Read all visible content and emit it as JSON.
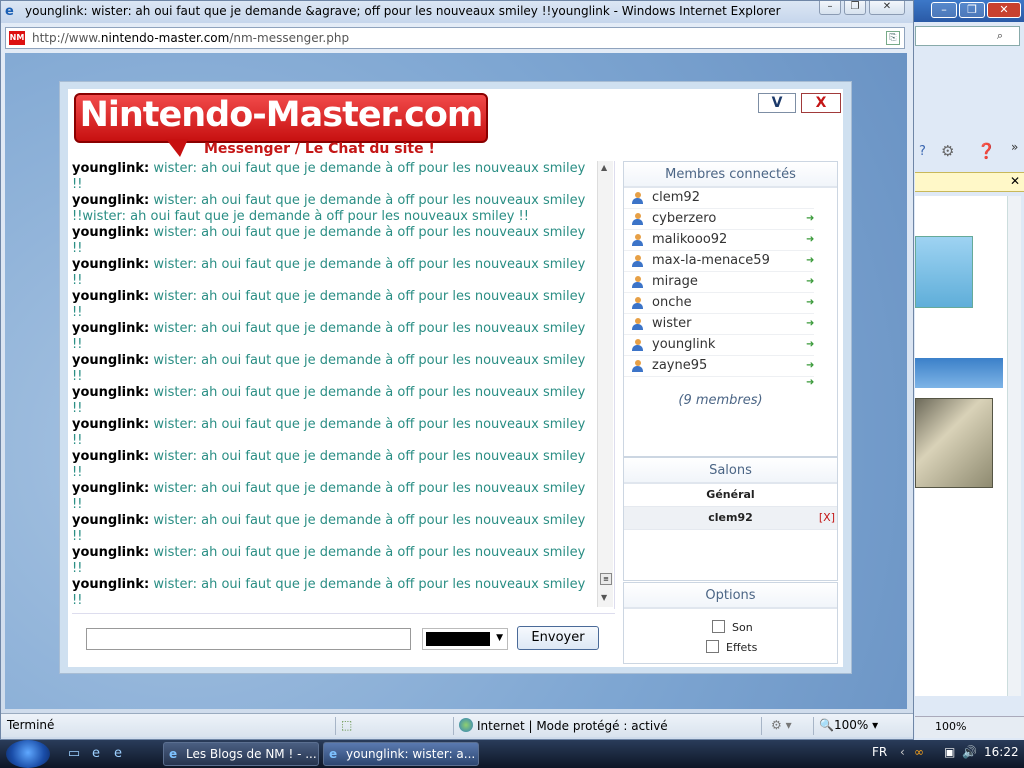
{
  "window": {
    "title": "younglink: wister: ah oui faut que je demande &agrave; off pour les nouveaux smiley !!younglink - Windows Internet Explorer",
    "url_prefix": "http://www.",
    "url_domain": "nintendo-master.com",
    "url_path": "/nm-messenger.php",
    "favicon_text": "NM"
  },
  "bg_window": {
    "zoom": "100%"
  },
  "chat": {
    "logo_text": "Nintendo-Master.com",
    "logo_subtitle": "Messenger / Le Chat du site !",
    "minimize_label": "V",
    "close_label": "X",
    "messages": [
      {
        "nick": "younglink:",
        "text": "wister: ah oui faut que je demande à off pour les nouveaux smiley !!"
      },
      {
        "nick": "younglink:",
        "text": "wister: ah oui faut que je demande à off pour les nouveaux smiley !!wister: ah oui faut que je demande à off pour les nouveaux smiley !!"
      },
      {
        "nick": "younglink:",
        "text": "wister: ah oui faut que je demande à off pour les nouveaux smiley !!"
      },
      {
        "nick": "younglink:",
        "text": "wister: ah oui faut que je demande à off pour les nouveaux smiley !!"
      },
      {
        "nick": "younglink:",
        "text": "wister: ah oui faut que je demande à off pour les nouveaux smiley !!"
      },
      {
        "nick": "younglink:",
        "text": "wister: ah oui faut que je demande à off pour les nouveaux smiley !!"
      },
      {
        "nick": "younglink:",
        "text": "wister: ah oui faut que je demande à off pour les nouveaux smiley !!"
      },
      {
        "nick": "younglink:",
        "text": "wister: ah oui faut que je demande à off pour les nouveaux smiley !!"
      },
      {
        "nick": "younglink:",
        "text": "wister: ah oui faut que je demande à off pour les nouveaux smiley !!"
      },
      {
        "nick": "younglink:",
        "text": "wister: ah oui faut que je demande à off pour les nouveaux smiley !!"
      },
      {
        "nick": "younglink:",
        "text": "wister: ah oui faut que je demande à off pour les nouveaux smiley !!"
      },
      {
        "nick": "younglink:",
        "text": "wister: ah oui faut que je demande à off pour les nouveaux smiley !!"
      },
      {
        "nick": "younglink:",
        "text": "wister: ah oui faut que je demande à off pour les nouveaux smiley !!"
      },
      {
        "nick": "younglink:",
        "text": "wister: ah oui faut que je demande à off pour les nouveaux smiley !!"
      }
    ],
    "input_value": "",
    "send_label": "Envoyer",
    "text_color": "#000000"
  },
  "members_panel": {
    "title": "Membres connectés",
    "members": [
      "clem92",
      "cyberzero",
      "malikooo92",
      "max-la-menace59",
      "mirage",
      "onche",
      "wister",
      "younglink",
      "zayne95"
    ],
    "count_text": "(9 membres)"
  },
  "rooms_panel": {
    "title": "Salons",
    "rooms": [
      {
        "name": "Général",
        "closable": false
      },
      {
        "name": "clem92",
        "closable": true,
        "close_label": "[X]"
      }
    ]
  },
  "options_panel": {
    "title": "Options",
    "options": [
      {
        "label": "Son",
        "checked": false
      },
      {
        "label": "Effets",
        "checked": false
      }
    ]
  },
  "statusbar": {
    "status": "Terminé",
    "zone": "Internet | Mode protégé : activé",
    "zoom": "100%"
  },
  "taskbar": {
    "tasks": [
      "Les Blogs de NM ! - ...",
      "younglink: wister: a..."
    ],
    "language": "FR",
    "time": "16:22"
  },
  "colors": {
    "message_text": "#2a8e84",
    "brand_red": "#c71010",
    "panel_title": "#4b6585"
  }
}
